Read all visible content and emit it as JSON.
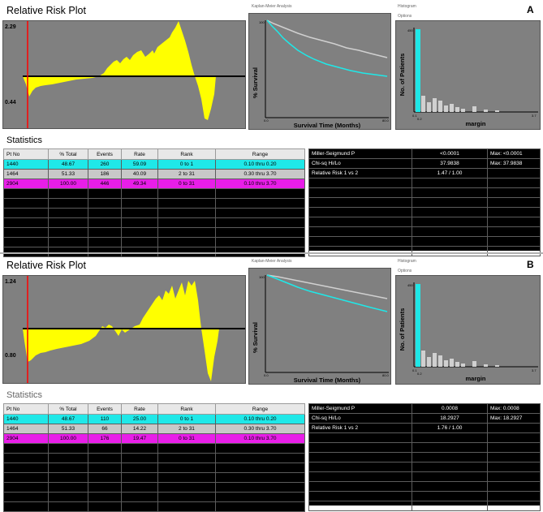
{
  "panels": [
    {
      "letter": "A",
      "risk_plot": {
        "title": "Relative Risk Plot",
        "y_max_label": "2.29",
        "y_min_label": "0.44"
      },
      "km": {
        "title": "Kaplan-Meier Analysis",
        "ylabel": "% Survival",
        "xlabel": "Survival Time (Months)",
        "y_top_tick": "100",
        "x_left_tick": "0.0",
        "x_right_tick": "80.0"
      },
      "hist": {
        "title": "Histogram",
        "menu": "Options",
        "ylabel": "No. of Patients",
        "xlabel": "margin",
        "y_top_tick": "450",
        "x_left_tick": "0.1",
        "x_mid_tick": "0.2",
        "x_right_tick": "3.7"
      },
      "stats_title": "Statistics",
      "table": {
        "headers": [
          "Pt No",
          "% Total",
          "Events",
          "Rate",
          "Rank",
          "Range"
        ],
        "rows": [
          [
            "1440",
            "48.67",
            "260",
            "59.09",
            "0 to 1",
            "0.10 thru 0.20"
          ],
          [
            "1464",
            "51.33",
            "186",
            "40.09",
            "2 to 31",
            "0.30 thru 3.70"
          ],
          [
            "2904",
            "100.00",
            "446",
            "49.34",
            "0 to 31",
            "0.10 thru 3.70"
          ]
        ]
      },
      "results": [
        [
          "Miller-Seigmund P",
          "<0.0001",
          "Max: <0.0001"
        ],
        [
          "Chi-sq Hi/Lo",
          "37.9838",
          "Max: 37.9838"
        ],
        [
          "Relative Risk 1 vs 2",
          "1.47 / 1.00",
          ""
        ]
      ]
    },
    {
      "letter": "B",
      "risk_plot": {
        "title": "Relative Risk Plot",
        "y_max_label": "1.24",
        "y_min_label": "0.80"
      },
      "km": {
        "title": "Kaplan-Meier Analysis",
        "ylabel": "% Survival",
        "xlabel": "Survival Time (Months)",
        "y_top_tick": "100",
        "x_left_tick": "0.0",
        "x_right_tick": "80.0"
      },
      "hist": {
        "title": "Histogram",
        "menu": "Options",
        "ylabel": "No. of Patients",
        "xlabel": "margin",
        "y_top_tick": "450",
        "x_left_tick": "0.1",
        "x_mid_tick": "0.2",
        "x_right_tick": "3.7"
      },
      "stats_title": "Statistics",
      "table": {
        "headers": [
          "Pt No",
          "% Total",
          "Events",
          "Rate",
          "Rank",
          "Range"
        ],
        "rows": [
          [
            "1440",
            "48.67",
            "110",
            "25.00",
            "0 to 1",
            "0.10 thru 0.20"
          ],
          [
            "1464",
            "51.33",
            "66",
            "14.22",
            "2 to 31",
            "0.30 thru 3.70"
          ],
          [
            "2904",
            "100.00",
            "176",
            "19.47",
            "0 to 31",
            "0.10 thru 3.70"
          ]
        ]
      },
      "results": [
        [
          "Miller-Seigmund P",
          "0.0008",
          "Max: 0.0008"
        ],
        [
          "Chi-sq Hi/Lo",
          "18.2927",
          "Max: 18.2927"
        ],
        [
          "Relative Risk 1 vs 2",
          "1.76 / 1.00",
          ""
        ]
      ]
    }
  ],
  "colors": {
    "plot_bg": "#808080",
    "risk_fill": "#ffff00",
    "cutoff_line": "#ff0000",
    "group1": "#1fe8e8",
    "group2": "#c8c8c8",
    "total": "#e81ee8"
  }
}
